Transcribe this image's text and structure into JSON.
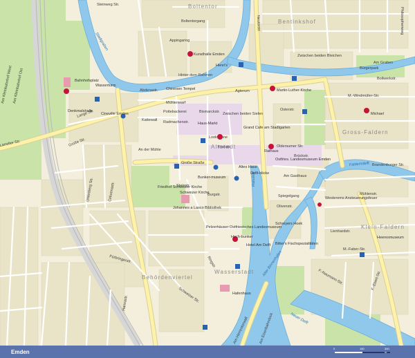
{
  "map": {
    "colors": {
      "land": "#f3efdc",
      "water": "#8fc8ea",
      "water_edge": "#6aaedb",
      "green": "#c9e3a8",
      "green_dark": "#b4d690",
      "block": "#e9e3c8",
      "block_center": "#e8d8ea",
      "road_major": "#fdf2a8",
      "road_edge": "#d8cf98",
      "road_minor": "#ffffff",
      "rail": "#b7b7b7",
      "accent": "#c4143a",
      "poi_blue": "#2a62b0"
    },
    "districts": [
      {
        "name": "Boltentor",
        "anchor": "top-center"
      },
      {
        "name": "Bentinkshof",
        "anchor": "top-right"
      },
      {
        "name": "Gross-Faldern",
        "anchor": "right"
      },
      {
        "name": "Altstadt",
        "anchor": "center"
      },
      {
        "name": "Klein-Faldern",
        "anchor": "right"
      },
      {
        "name": "Behördenviertel",
        "anchor": "bottom-left"
      },
      {
        "name": "Wasserstadt",
        "anchor": "bottom-center"
      }
    ],
    "streets": [
      "Steinweg Str.",
      "Am Tonnenhof",
      "Boltentorgang",
      "Appingaring",
      "Meister-Gerrits-Str.",
      "Gnaßestr.",
      "Grasstr.",
      "Abdenastr.",
      "Hinter dem Rahmen",
      "Mühlenwarf",
      "Pottebackerei",
      "Bismarckstr.",
      "Zwischen beiden Sielen",
      "Kattewall",
      "Radmachenstr.",
      "Agterum",
      "Neutorstr.",
      "Hindenburg",
      "Große Str.",
      "Große Straße",
      "An der Mühle",
      "Lookvenne",
      "Brückstr.",
      "Am Stadtgarten",
      "Kranstr.",
      "Steinstr.",
      "Kirchstr.",
      "Burgstr.",
      "Zwischen beiden Bleichen",
      "Am Graben",
      "Bollwerkstr.",
      "Osterstr.",
      "Wallstr.",
      "Am Wall",
      "Oldersumer Str.",
      "Am Gasthaus",
      "Spiegelgang",
      "Olivenstr.",
      "Mühlenstr.",
      "Am Delft",
      "Ringstr.",
      "Friedhofstr.",
      "Neutorstr.",
      "Schweizer Str.",
      "Sandstr.",
      "Bolardusstr.",
      "Friesenstr.",
      "Emsstr.",
      "Am Hafen",
      "Larrelter Str.",
      "Lange Str.",
      "Am Kleinbahnhof West",
      "Am Kleinbahnhof Ost",
      "Grünewaldstr.",
      "Tutergaststr.",
      "Uhlenberg Str.",
      "Cirksenastr.",
      "Bürgermeister-Schmidt-Str.",
      "Kleine Osterstr.",
      "Nessestr.",
      "Liesbethstr.",
      "Hermann-Allmers-Str.",
      "Fürbringerstr.",
      "Graf-Edzard-Str.",
      "Daalerstr.",
      "Hansastr.",
      "Am Herrentorwall",
      "Am Eisenbahndock",
      "Neuer Delft",
      "Ratsdelft",
      "Falderndelft",
      "Alter Binnenhafen",
      "Stadtgraben",
      "Fehntjer Tief",
      "Emder Hafenbahn",
      "M.-Windmüller-Str.",
      "Am Löwenbürger",
      "Brandenburger Str.",
      "Westerems",
      "Lienhardstr.",
      "M.-Faber-Str.",
      "F.-Naumann-Str.",
      "F.-Ebert-Str.",
      "H.-Schnell-Str.",
      "Philosophenweg",
      "Rabbiner-Hirsch-Str.",
      "G.-Bauer-Str.",
      "Ringstr.",
      "Am Wasserturm",
      "Schulstr.",
      "Gräfin-Anna-Str.",
      "Rektor-Ubbo-Str."
    ],
    "pois": [
      "Kunsthalle Emden",
      "Henri's",
      "Bahnhofsplatz",
      "Wasserturm",
      "Chinesen Tempel",
      "Martin-Luther-Kirche",
      "Michael",
      "Neue Kirche",
      "Denkmalshalle",
      "Cineville Emden",
      "Haus-Markt",
      "Grand Cafe am Stadtgarten",
      "Kunsthandwerk",
      "Altes Haus",
      "Hafentor",
      "Delft-blicke",
      "Ostfries. Landesmuseum Emden",
      "Rathaus",
      "Goldener Adler",
      "Bunker-museum",
      "Schweizer Kirche",
      "Johannes a Lasco Bibliothek",
      "Pelzerhäuser Ostfriesisches Landesmuseum",
      "Hoch-bunker",
      "Hotel Am Delft",
      "Schreyers Hoek",
      "Bitter's Fischspezialitäten",
      "Westerems Ansteuerungsfeuer",
      "Pierhaus",
      "Hafenhaus",
      "Heeresmuseum",
      "Friedhof Schweizer Kirche",
      "Friedhof Bollwerk",
      "Bürgerpark",
      "Ev. ref. Kirche",
      "Altref. Kirche",
      "Neue Kirche"
    ],
    "waters": [
      "Stadtgraben",
      "Ratsdelft",
      "Falderndelft",
      "Alter Binnenhafen",
      "Neuer Delft"
    ]
  },
  "footer": {
    "title": "Emden",
    "scale": {
      "labels": [
        "0",
        "150",
        "300 m"
      ]
    }
  }
}
